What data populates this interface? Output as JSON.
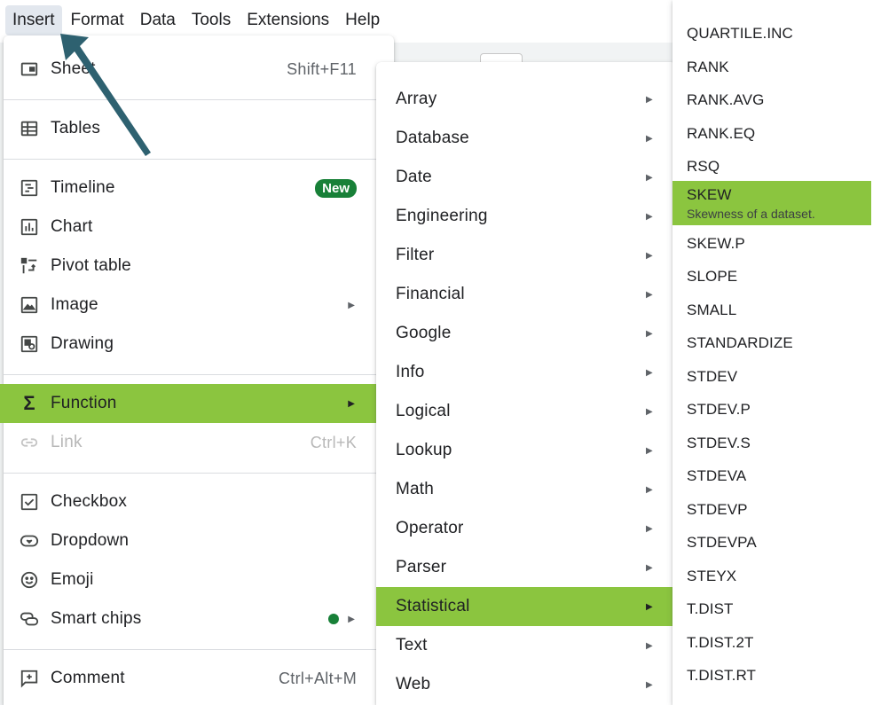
{
  "menubar": {
    "items": [
      {
        "label": "Insert",
        "active": true
      },
      {
        "label": "Format"
      },
      {
        "label": "Data"
      },
      {
        "label": "Tools"
      },
      {
        "label": "Extensions"
      },
      {
        "label": "Help"
      }
    ]
  },
  "insert_menu": {
    "sheet": {
      "label": "Sheet",
      "shortcut": "Shift+F11",
      "icon": "sheet-icon"
    },
    "tables": {
      "label": "Tables",
      "icon": "table-icon"
    },
    "timeline": {
      "label": "Timeline",
      "badge": "New",
      "icon": "timeline-icon"
    },
    "chart": {
      "label": "Chart",
      "icon": "chart-icon"
    },
    "pivot": {
      "label": "Pivot table",
      "icon": "pivot-table-icon"
    },
    "image": {
      "label": "Image",
      "icon": "image-icon"
    },
    "drawing": {
      "label": "Drawing",
      "icon": "drawing-icon"
    },
    "function": {
      "label": "Function",
      "icon": "sigma-icon"
    },
    "link": {
      "label": "Link",
      "shortcut": "Ctrl+K",
      "icon": "link-icon"
    },
    "checkbox": {
      "label": "Checkbox",
      "icon": "checkbox-icon"
    },
    "dropdown": {
      "label": "Dropdown",
      "icon": "dropdown-icon"
    },
    "emoji": {
      "label": "Emoji",
      "icon": "emoji-icon"
    },
    "smart_chips": {
      "label": "Smart chips",
      "icon": "smart-chips-icon"
    },
    "comment": {
      "label": "Comment",
      "shortcut": "Ctrl+Alt+M",
      "icon": "comment-icon"
    }
  },
  "function_menu": {
    "items": [
      {
        "label": "Array"
      },
      {
        "label": "Database"
      },
      {
        "label": "Date"
      },
      {
        "label": "Engineering"
      },
      {
        "label": "Filter"
      },
      {
        "label": "Financial"
      },
      {
        "label": "Google"
      },
      {
        "label": "Info"
      },
      {
        "label": "Logical"
      },
      {
        "label": "Lookup"
      },
      {
        "label": "Math"
      },
      {
        "label": "Operator"
      },
      {
        "label": "Parser"
      },
      {
        "label": "Statistical",
        "highlight": true
      },
      {
        "label": "Text"
      },
      {
        "label": "Web"
      }
    ]
  },
  "statistical_menu": {
    "items": [
      {
        "label": "QUARTILE.INC"
      },
      {
        "label": "RANK"
      },
      {
        "label": "RANK.AVG"
      },
      {
        "label": "RANK.EQ"
      },
      {
        "label": "RSQ"
      },
      {
        "label": "SKEW",
        "description": "Skewness of a dataset.",
        "highlight": true
      },
      {
        "label": "SKEW.P"
      },
      {
        "label": "SLOPE"
      },
      {
        "label": "SMALL"
      },
      {
        "label": "STANDARDIZE"
      },
      {
        "label": "STDEV"
      },
      {
        "label": "STDEV.P"
      },
      {
        "label": "STDEV.S"
      },
      {
        "label": "STDEVA"
      },
      {
        "label": "STDEVP"
      },
      {
        "label": "STDEVPA"
      },
      {
        "label": "STEYX"
      },
      {
        "label": "T.DIST"
      },
      {
        "label": "T.DIST.2T"
      },
      {
        "label": "T.DIST.RT"
      }
    ]
  },
  "colors": {
    "highlight": "#8bc53f",
    "badge": "#188038",
    "annotation_arrow": "#2e6170"
  }
}
